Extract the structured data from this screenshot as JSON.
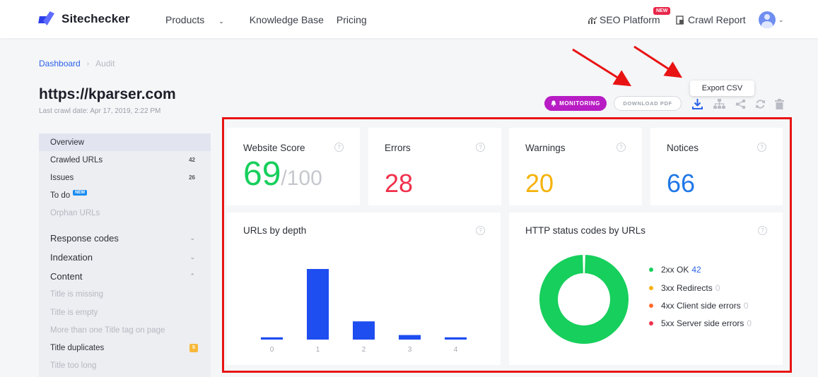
{
  "nav": {
    "brand": "Sitechecker",
    "links": [
      "Products",
      "Knowledge Base",
      "Pricing"
    ],
    "seo_platform": "SEO Platform",
    "new_badge": "NEW",
    "crawl_report": "Crawl Report"
  },
  "breadcrumb": {
    "dashboard": "Dashboard",
    "sep": "›",
    "current": "Audit"
  },
  "header": {
    "site_url": "https://kparser.com",
    "last_crawl": "Last crawl date: Apr 17, 2019, 2:22 PM",
    "monitoring_label": "MONITORING",
    "download_pdf_label": "DOWNLOAD PDF",
    "export_tooltip": "Export CSV"
  },
  "sidebar": {
    "items": [
      {
        "label": "Overview"
      },
      {
        "label": "Crawled URLs",
        "count": "42"
      },
      {
        "label": "Issues",
        "count": "26"
      },
      {
        "label": "To do",
        "badge": "NEW"
      },
      {
        "label": "Orphan URLs"
      },
      {
        "label": "Response codes"
      },
      {
        "label": "Indexation"
      },
      {
        "label": "Content"
      },
      {
        "label": "Title is missing"
      },
      {
        "label": "Title is empty"
      },
      {
        "label": "More than one Title tag on page"
      },
      {
        "label": "Title duplicates",
        "count": "5"
      },
      {
        "label": "Title too long"
      }
    ]
  },
  "stats": {
    "score_label": "Website Score",
    "score_value": "69",
    "score_max": "/100",
    "errors_label": "Errors",
    "errors_value": "28",
    "warnings_label": "Warnings",
    "warnings_value": "20",
    "notices_label": "Notices",
    "notices_value": "66"
  },
  "colors": {
    "score": "#17cf5c",
    "errors": "#f0304c",
    "warnings": "#f5b20a",
    "notices": "#1f78e8",
    "accent": "#2b62e8",
    "monitoring": "#b81cc4",
    "frame": "#e81414"
  },
  "chart_data": [
    {
      "type": "bar",
      "title": "URLs by depth",
      "categories": [
        "0",
        "1",
        "2",
        "3",
        "4"
      ],
      "values": [
        1,
        31,
        8,
        2,
        1
      ],
      "color": "#1e4df0"
    },
    {
      "type": "pie",
      "title": "HTTP status codes by URLs",
      "labels": [
        "2xx OK",
        "3xx Redirects",
        "4xx Client side errors",
        "5xx Server side errors"
      ],
      "values": [
        42,
        0,
        0,
        0
      ],
      "colors": [
        "#17cf5c",
        "#f5b20a",
        "#ff6a2b",
        "#f0304c"
      ],
      "value_colors": [
        "#2b62e8",
        "#c6c8ce",
        "#c6c8ce",
        "#c6c8ce"
      ]
    }
  ]
}
